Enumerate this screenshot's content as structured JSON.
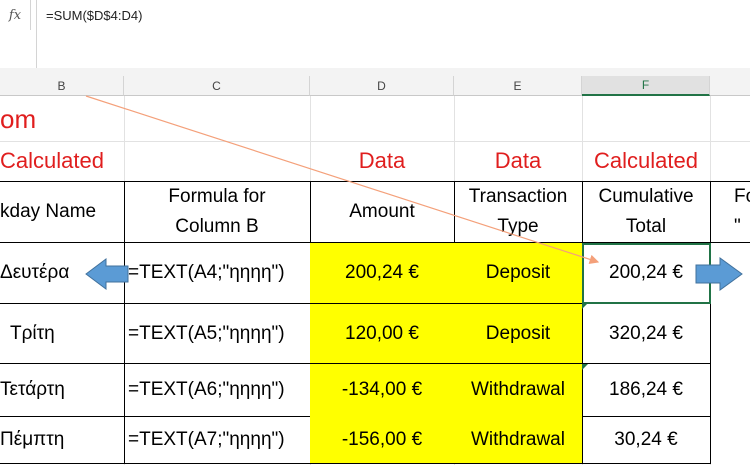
{
  "formula_bar": {
    "fx_label": "fx",
    "formula": "=SUM($D$4:D4)"
  },
  "columns": [
    "B",
    "C",
    "D",
    "E",
    "F"
  ],
  "sheet": {
    "title_fragment": "om",
    "row_labels": [
      "Calculated",
      "Data",
      "Data",
      "Calculated"
    ],
    "headers": {
      "b": "kday Name",
      "c_line1": "Formula for",
      "c_line2": "Column B",
      "d": "Amount",
      "e_line1": "Transaction",
      "e_line2": "Type",
      "f_line1": "Cumulative",
      "f_line2": "Total",
      "g_line1": "Fo",
      "g_line2": "\""
    },
    "rows": [
      {
        "day": "Δευτέρα",
        "formula": "=TEXT(A4;\"ηηηη\")",
        "amount": "200,24 €",
        "type": "Deposit",
        "total": "200,24 €"
      },
      {
        "day": "Τρίτη",
        "formula": "=TEXT(A5;\"ηηηη\")",
        "amount": "120,00 €",
        "type": "Deposit",
        "total": "320,24 €"
      },
      {
        "day": "Τετάρτη",
        "formula": "=TEXT(A6;\"ηηηη\")",
        "amount": "-134,00 €",
        "type": "Withdrawal",
        "total": "186,24 €"
      },
      {
        "day": "Πέμπτη",
        "formula": "=TEXT(A7;\"ηηηη\")",
        "amount": "-156,00 €",
        "type": "Withdrawal",
        "total": "30,24 €"
      }
    ]
  },
  "colors": {
    "highlight": "#ffff00",
    "label_red": "#e01e1e",
    "arrow_blue": "#5b9bd5",
    "pointer_orange": "#f4a07a",
    "selection_green": "#217346"
  }
}
